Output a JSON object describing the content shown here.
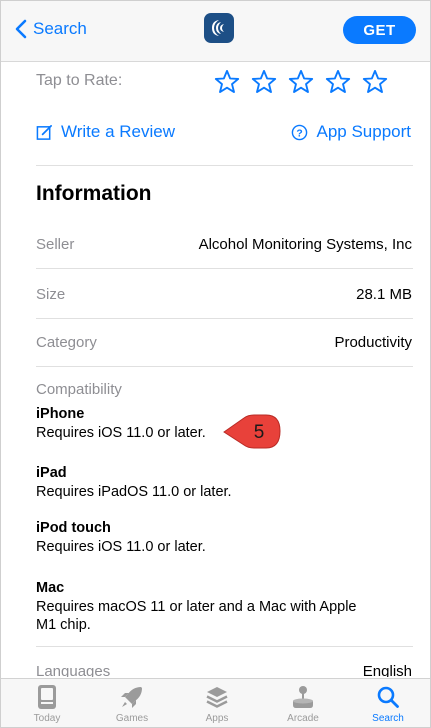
{
  "nav": {
    "back_label": "Search",
    "get_label": "GET"
  },
  "rating": {
    "label": "Tap to Rate:",
    "stars": 5
  },
  "links": {
    "write_review": "Write a Review",
    "app_support": "App Support"
  },
  "information": {
    "title": "Information",
    "rows": [
      {
        "key": "Seller",
        "value": "Alcohol Monitoring Systems, Inc"
      },
      {
        "key": "Size",
        "value": "28.1 MB"
      },
      {
        "key": "Category",
        "value": "Productivity"
      }
    ],
    "compatibility_label": "Compatibility",
    "devices": [
      {
        "name": "iPhone",
        "requirement": "Requires iOS 11.0 or later."
      },
      {
        "name": "iPad",
        "requirement": "Requires iPadOS 11.0 or later."
      },
      {
        "name": "iPod touch",
        "requirement": "Requires iOS 11.0 or later."
      },
      {
        "name": "Mac",
        "requirement": "Requires macOS 11 or later and a Mac with Apple M1 chip."
      }
    ],
    "languages_label": "Languages",
    "languages_value": "English"
  },
  "callout": {
    "number": "5",
    "color": "#e8413a"
  },
  "tabs": [
    {
      "label": "Today",
      "icon": "today-icon"
    },
    {
      "label": "Games",
      "icon": "rocket-icon"
    },
    {
      "label": "Apps",
      "icon": "apps-stack-icon"
    },
    {
      "label": "Arcade",
      "icon": "arcade-joystick-icon"
    },
    {
      "label": "Search",
      "icon": "search-icon",
      "active": true
    }
  ],
  "colors": {
    "accent": "#0a7aff",
    "secondary_text": "#8e8e93"
  }
}
